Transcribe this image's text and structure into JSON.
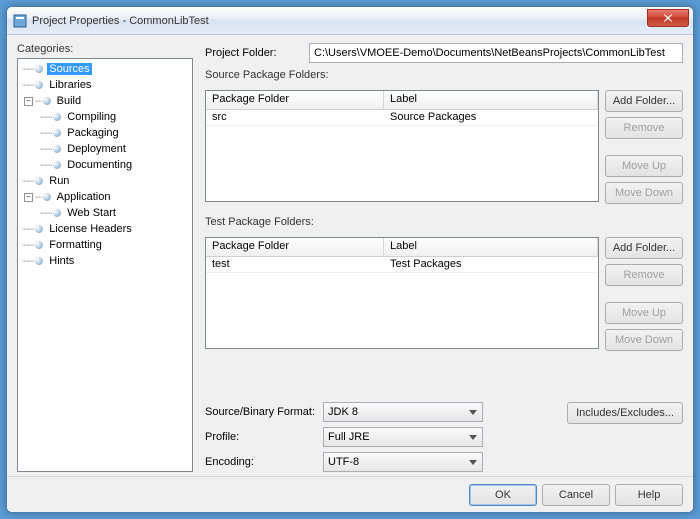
{
  "window": {
    "title": "Project Properties - CommonLibTest"
  },
  "categories": {
    "label": "Categories:",
    "items": [
      {
        "label": "Sources",
        "level": 0,
        "expander": "",
        "prefix": "┈○",
        "selected": true
      },
      {
        "label": "Libraries",
        "level": 0,
        "expander": "",
        "prefix": "┈○"
      },
      {
        "label": "Build",
        "level": 0,
        "expander": "minus",
        "prefix": ""
      },
      {
        "label": "Compiling",
        "level": 1,
        "expander": "",
        "prefix": "┈○"
      },
      {
        "label": "Packaging",
        "level": 1,
        "expander": "",
        "prefix": "┈○"
      },
      {
        "label": "Deployment",
        "level": 1,
        "expander": "",
        "prefix": "┈○"
      },
      {
        "label": "Documenting",
        "level": 1,
        "expander": "",
        "prefix": "┈○"
      },
      {
        "label": "Run",
        "level": 0,
        "expander": "",
        "prefix": "┈○"
      },
      {
        "label": "Application",
        "level": 0,
        "expander": "minus",
        "prefix": ""
      },
      {
        "label": "Web Start",
        "level": 1,
        "expander": "",
        "prefix": "┈○"
      },
      {
        "label": "License Headers",
        "level": 0,
        "expander": "",
        "prefix": "┈○"
      },
      {
        "label": "Formatting",
        "level": 0,
        "expander": "",
        "prefix": "┈○"
      },
      {
        "label": "Hints",
        "level": 0,
        "expander": "",
        "prefix": "┈○"
      }
    ]
  },
  "project_folder": {
    "label": "Project Folder:",
    "value": "C:\\Users\\VMOEE-Demo\\Documents\\NetBeansProjects\\CommonLibTest"
  },
  "source_folders": {
    "label": "Source Package Folders:",
    "col_folder": "Package Folder",
    "col_label": "Label",
    "rows": [
      {
        "folder": "src",
        "label": "Source Packages"
      }
    ],
    "buttons": {
      "add": "Add Folder...",
      "remove": "Remove",
      "up": "Move Up",
      "down": "Move Down"
    }
  },
  "test_folders": {
    "label": "Test Package Folders:",
    "col_folder": "Package Folder",
    "col_label": "Label",
    "rows": [
      {
        "folder": "test",
        "label": "Test Packages"
      }
    ],
    "buttons": {
      "add": "Add Folder...",
      "remove": "Remove",
      "up": "Move Up",
      "down": "Move Down"
    }
  },
  "bottom": {
    "source_binary_label": "Source/Binary Format:",
    "source_binary_value": "JDK 8",
    "profile_label": "Profile:",
    "profile_value": "Full JRE",
    "encoding_label": "Encoding:",
    "encoding_value": "UTF-8",
    "includes_excludes": "Includes/Excludes..."
  },
  "footer": {
    "ok": "OK",
    "cancel": "Cancel",
    "help": "Help"
  }
}
